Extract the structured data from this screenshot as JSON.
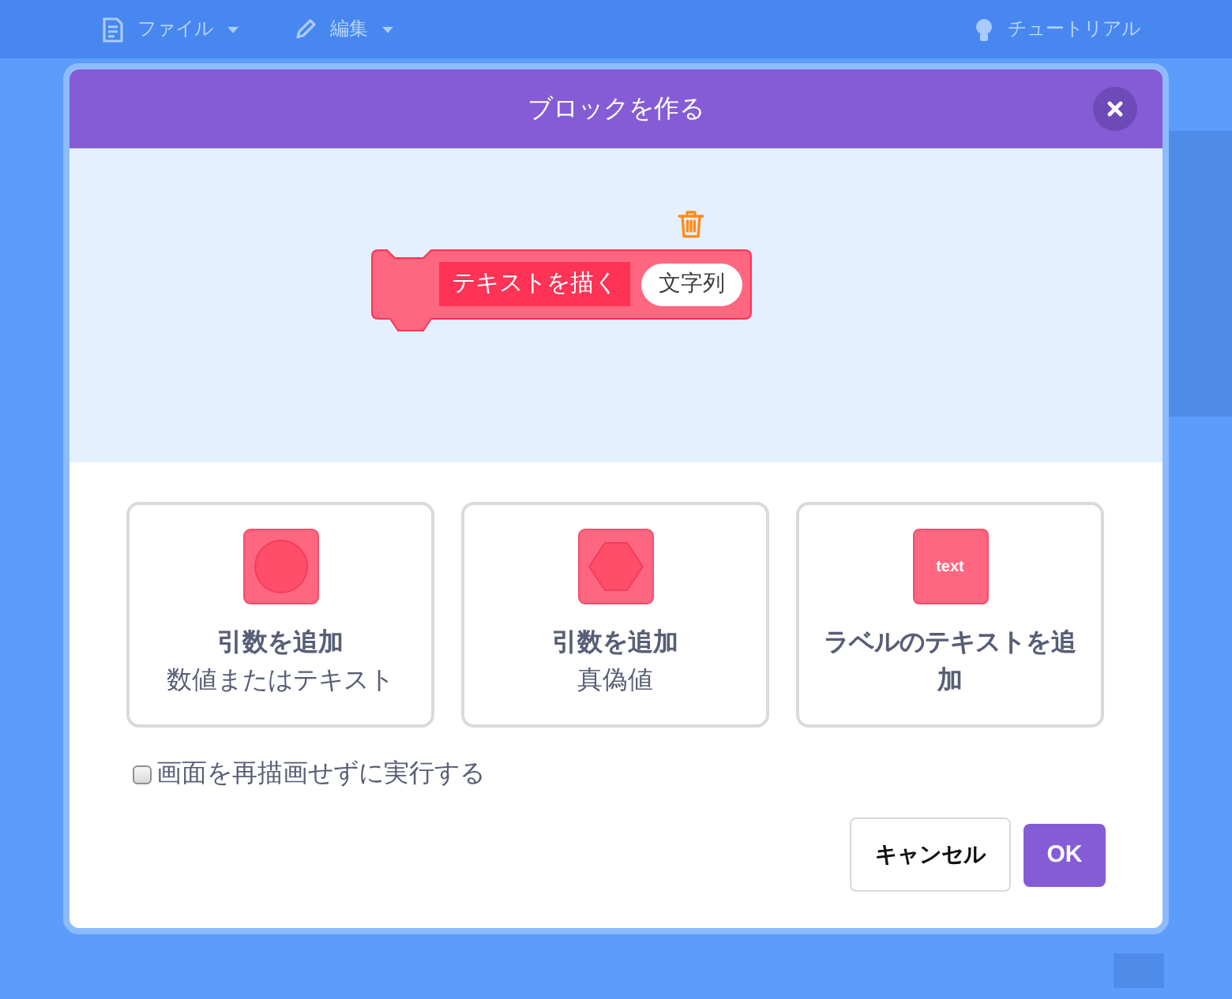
{
  "menu_bar": {
    "items": [
      {
        "kind": "file",
        "label": "ファイル",
        "dropdown": true
      },
      {
        "kind": "edit",
        "label": "編集",
        "dropdown": true
      },
      {
        "kind": "tutorials",
        "label": "チュートリアル",
        "dropdown": false
      }
    ]
  },
  "dialog": {
    "title": "ブロックを作る",
    "block": {
      "label": "テキストを描く",
      "argument": "文字列"
    },
    "options": [
      {
        "kind": "number_or_text",
        "title": "引数を追加",
        "subtitle": "数値またはテキスト"
      },
      {
        "kind": "boolean",
        "title": "引数を追加",
        "subtitle": "真偽値"
      },
      {
        "kind": "label",
        "title": "ラベルのテキストを追加",
        "icon_text": "text"
      }
    ],
    "run_without_refresh": {
      "label": "画面を再描画せずに実行する",
      "checked": false
    },
    "buttons": [
      {
        "kind": "cancel",
        "label": "キャンセル"
      },
      {
        "kind": "ok",
        "label": "OK"
      }
    ]
  }
}
